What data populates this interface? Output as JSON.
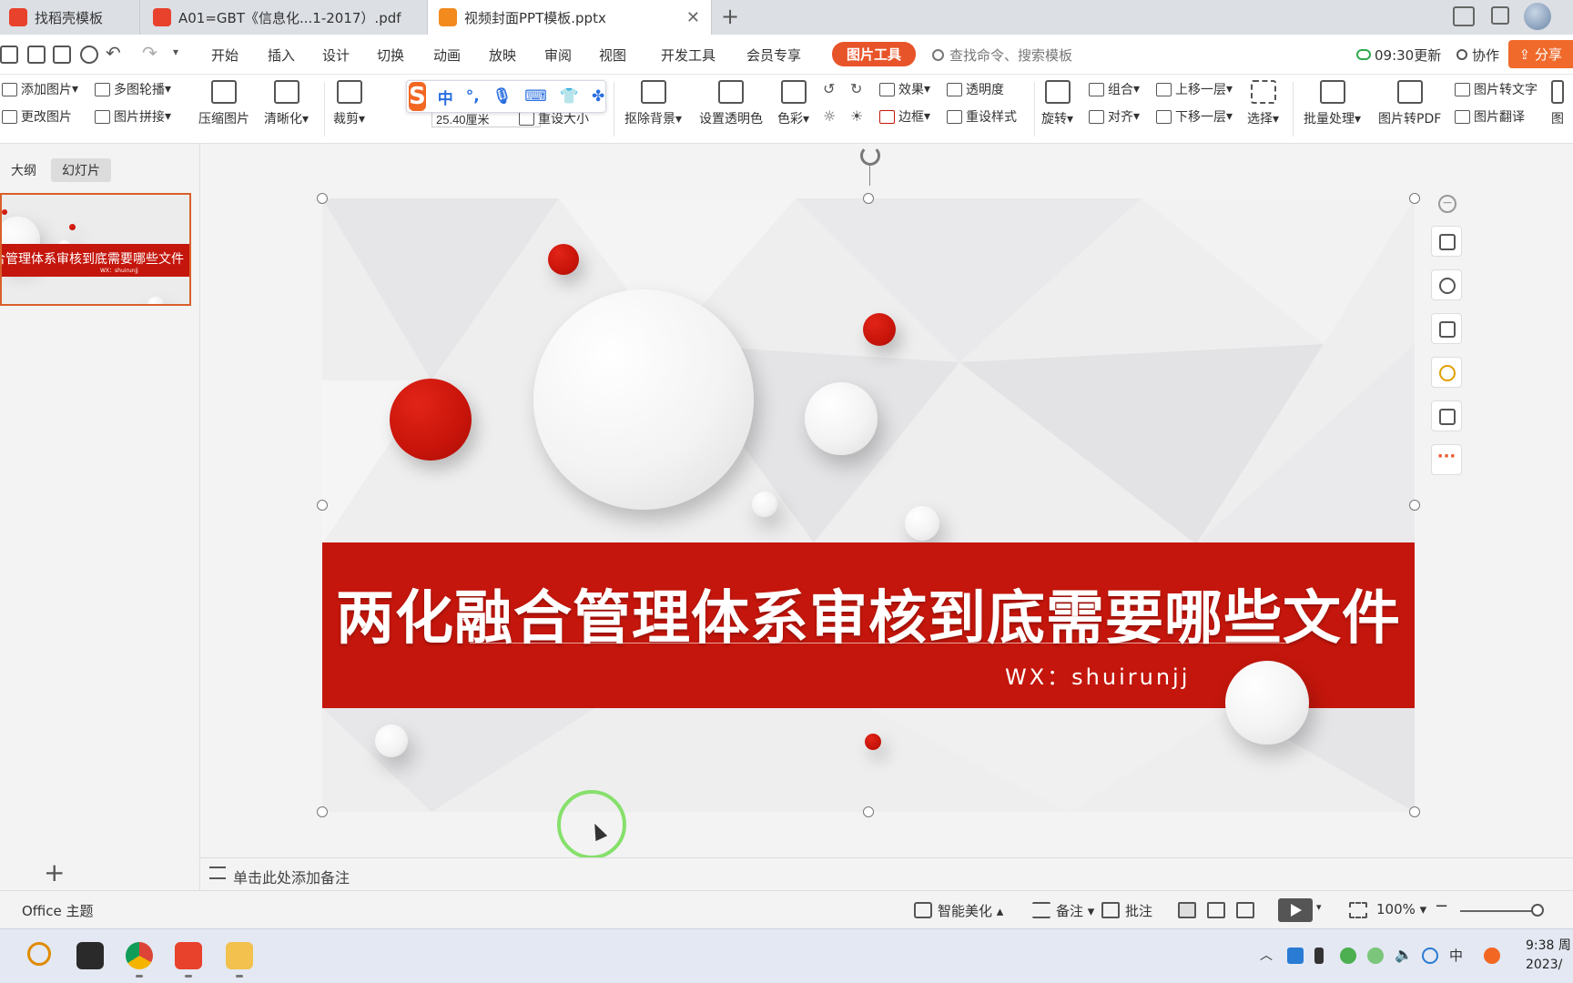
{
  "tabs": [
    {
      "label": "找稻壳模板",
      "active": false
    },
    {
      "label": "A01=GBT《信息化...1-2017）.pdf",
      "active": false
    },
    {
      "label": "视频封面PPT模板.pptx",
      "active": true
    }
  ],
  "menu": {
    "items": [
      "开始",
      "插入",
      "设计",
      "切换",
      "动画",
      "放映",
      "审阅",
      "视图",
      "开发工具",
      "会员专享"
    ],
    "picture_tools": "图片工具",
    "search_placeholder": "查找命令、搜索模板",
    "update": "09:30更新",
    "collab": "协作",
    "share": "分享"
  },
  "ribbon": {
    "add_picture": "添加图片",
    "multi_carousel": "多图轮播",
    "change_picture": "更改图片",
    "picture_mosaic": "图片拼接",
    "compress": "压缩图片",
    "sharpen": "清晰化",
    "crop": "裁剪",
    "size_value": "25.40厘米",
    "reset_size": "重设大小",
    "remove_bg": "抠除背景",
    "set_transparent": "设置透明色",
    "color": "色彩",
    "effects": "效果",
    "transparency": "透明度",
    "border": "边框",
    "reset_style": "重设样式",
    "rotate": "旋转",
    "group": "组合",
    "align": "对齐",
    "bring_forward": "上移一层",
    "send_backward": "下移一层",
    "select": "选择",
    "batch": "批量处理",
    "to_pdf": "图片转PDF",
    "to_text": "图片转文字",
    "translate": "图片翻译",
    "cut_last": "图"
  },
  "ime": {
    "mode": "中",
    "punct": "°,"
  },
  "left_panel": {
    "tab_outline": "大纲",
    "tab_slides": "幻灯片",
    "thumb_title": "合管理体系审核到底需要哪些文件",
    "thumb_sub": "WX：shuirunjj"
  },
  "slide": {
    "title": "两化融合管理体系审核到底需要哪些文件",
    "subtitle": "WX：shuirunjj"
  },
  "notes_placeholder": "单击此处添加备注",
  "status": {
    "theme": "Office 主题",
    "beautify": "智能美化",
    "notes": "备注",
    "comments": "批注",
    "zoom": "100%"
  },
  "clock": {
    "time": "9:38 周",
    "date": "2023/"
  },
  "colors": {
    "accent": "#e8542a",
    "slide_red": "#c4160c"
  }
}
